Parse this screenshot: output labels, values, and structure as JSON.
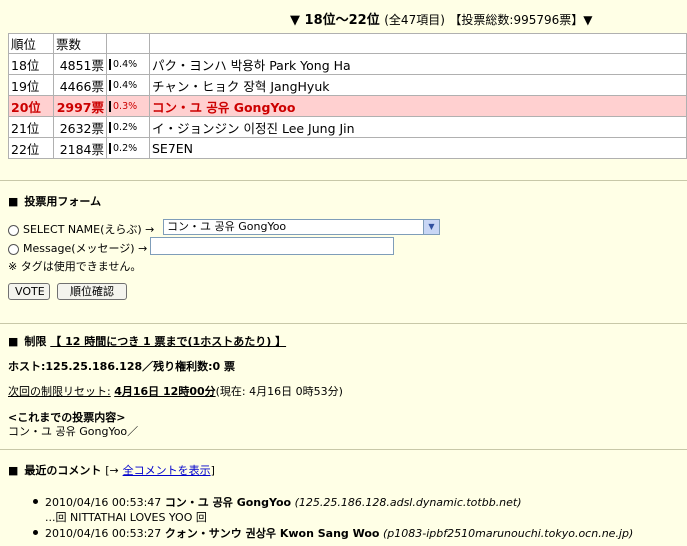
{
  "header": {
    "range": "▼ 18位～22位",
    "total_items": "(全47項目)",
    "total_votes": "【投票総数:995796票】▼"
  },
  "table": {
    "col_rank": "順位",
    "col_votes": "票数",
    "rows": [
      {
        "rank": "18位",
        "votes": "4851票",
        "pct": "0.4%",
        "name": "パク・ヨンハ 박용하 Park Yong Ha",
        "highlight": false
      },
      {
        "rank": "19位",
        "votes": "4466票",
        "pct": "0.4%",
        "name": "チャン・ヒョク 장혁 JangHyuk",
        "highlight": false
      },
      {
        "rank": "20位",
        "votes": "2997票",
        "pct": "0.3%",
        "name": "コン・ユ 공유 GongYoo",
        "highlight": true
      },
      {
        "rank": "21位",
        "votes": "2632票",
        "pct": "0.2%",
        "name": "イ・ジョンジン 이정진 Lee Jung Jin",
        "highlight": false
      },
      {
        "rank": "22位",
        "votes": "2184票",
        "pct": "0.2%",
        "name": "SE7EN",
        "highlight": false
      }
    ]
  },
  "form": {
    "title": "投票用フォーム",
    "select_label": "SELECT NAME(えらぶ) →",
    "select_value": "コン・ユ 공유 GongYoo",
    "message_label": "Message(メッセージ) →",
    "tag_note": "※ タグは使用できません。",
    "vote_button": "VOTE",
    "rank_button": "順位確認"
  },
  "limit": {
    "title": "制限",
    "rule": "【 12 時間につき 1 票まで(1ホストあたり) 】",
    "host_line": "ホスト:125.25.186.128／残り権利数:0 票",
    "reset_prefix": "次回の制限リセット:",
    "reset_time": "4月16日 12時00分",
    "now": "(現在: 4月16日 0時53分)",
    "history_title": "<これまでの投票内容>",
    "history_value": "コン・ユ 공유 GongYoo／"
  },
  "comments": {
    "title": "最近のコメント",
    "open_bracket": "[→",
    "show_all": "全コメントを表示",
    "close_bracket": "]",
    "items": [
      {
        "time": "2010/04/16 00:53:47",
        "name": "コン・ユ 공유 GongYoo",
        "host": "(125.25.186.128.adsl.dynamic.totbb.net)",
        "text": "...回 NITTATHAI LOVES YOO 回"
      },
      {
        "time": "2010/04/16 00:53:27",
        "name": "クォン・サンウ 권상우 Kwon Sang Woo",
        "host": "(p1083-ipbf2510marunouchi.tokyo.ocn.ne.jp)",
        "text": ""
      }
    ]
  }
}
